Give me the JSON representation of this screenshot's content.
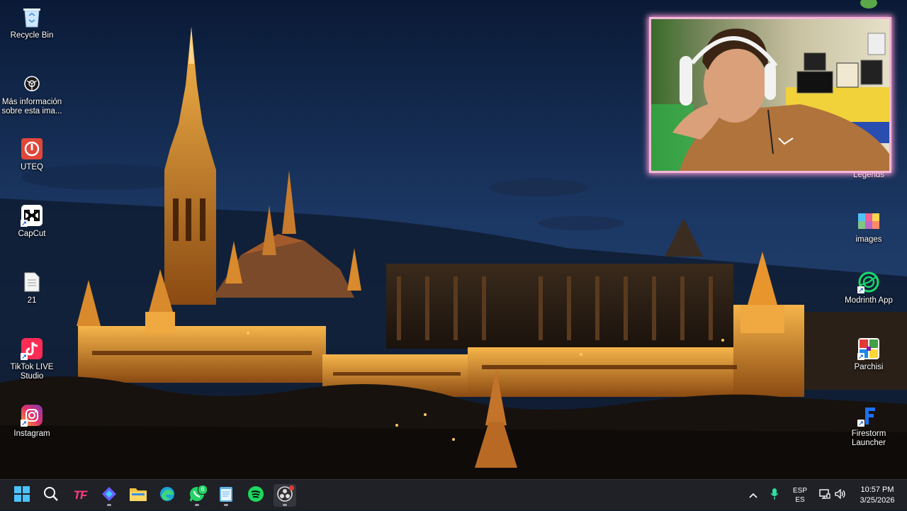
{
  "desktop": {
    "left_icons": [
      {
        "label": "Recycle Bin",
        "icon": "recycle-bin-icon"
      },
      {
        "label": "Más información sobre esta ima...",
        "icon": "camera-info-icon"
      },
      {
        "label": "UTEQ",
        "icon": "power-icon"
      },
      {
        "label": "CapCut",
        "icon": "capcut-icon"
      },
      {
        "label": "21",
        "icon": "text-file-icon"
      },
      {
        "label": "TikTok LIVE Studio",
        "icon": "tiktok-live-icon"
      },
      {
        "label": "Instagram",
        "icon": "instagram-icon"
      }
    ],
    "right_icons": [
      {
        "label": "Legends",
        "icon": "legends-icon"
      },
      {
        "label": "images",
        "icon": "image-folder-icon"
      },
      {
        "label": "Modrinth App",
        "icon": "modrinth-icon"
      },
      {
        "label": "Parchisi",
        "icon": "parchisi-icon"
      },
      {
        "label": "Firestorm Launcher",
        "icon": "firestorm-icon"
      }
    ]
  },
  "webcam": {
    "border_color": "#f4b8d8",
    "glow_color": "#ff9bd3"
  },
  "taskbar": {
    "apps": [
      {
        "name": "start",
        "icon": "windows-start-icon"
      },
      {
        "name": "search",
        "icon": "search-icon"
      },
      {
        "name": "tf",
        "label": "TF",
        "icon": "tf-app-icon"
      },
      {
        "name": "app-diamond",
        "icon": "diamond-app-icon"
      },
      {
        "name": "file-explorer",
        "icon": "folder-icon"
      },
      {
        "name": "edge",
        "icon": "edge-icon"
      },
      {
        "name": "whatsapp",
        "icon": "whatsapp-icon",
        "badge": "6"
      },
      {
        "name": "notepad",
        "icon": "notepad-icon"
      },
      {
        "name": "spotify",
        "icon": "spotify-icon"
      },
      {
        "name": "obs",
        "icon": "obs-icon"
      }
    ],
    "tray": {
      "lang_line1": "ESP",
      "lang_line2": "ES",
      "time": "10:57 PM",
      "date": "3/25/2026"
    }
  },
  "colors": {
    "taskbar_bg": "#1f2126",
    "sky_top": "#0b1c3a",
    "castle_glow": "#f2a23a"
  }
}
